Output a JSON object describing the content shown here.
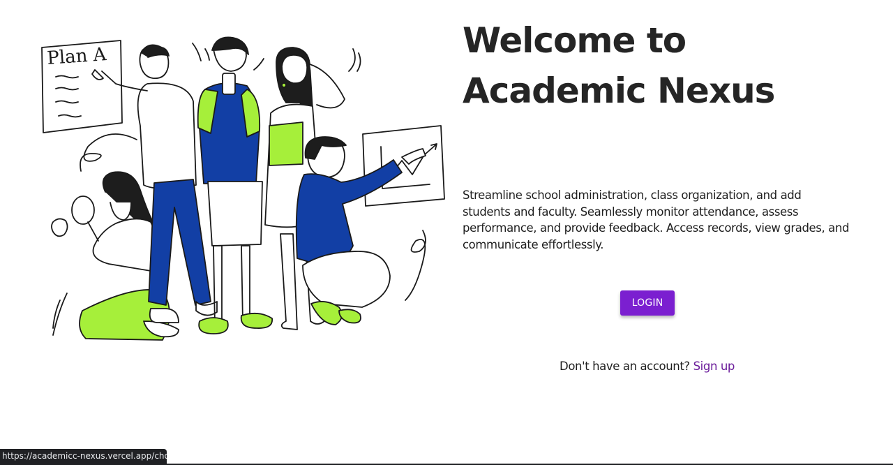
{
  "hero": {
    "title": "Welcome to Academic Nexus",
    "description": "Streamline school administration, class organization, and add students and faculty. Seamlessly monitor attendance, assess performance, and provide feedback. Access records, view grades, and communicate effortlessly."
  },
  "illustration": {
    "board_text": "Plan A",
    "icon": "people-collaborating-illustration"
  },
  "auth": {
    "login_label": "LOGIN",
    "signup_prompt": "Don't have an account?",
    "signup_link": "Sign up"
  },
  "status_bar": {
    "url": "https://academicc-nexus.vercel.app/choose"
  },
  "colors": {
    "accent": "#7b1fd0",
    "link": "#6a1b9a",
    "illustration_green": "#a6ef3a",
    "illustration_blue": "#123fa5",
    "text": "#252525"
  }
}
